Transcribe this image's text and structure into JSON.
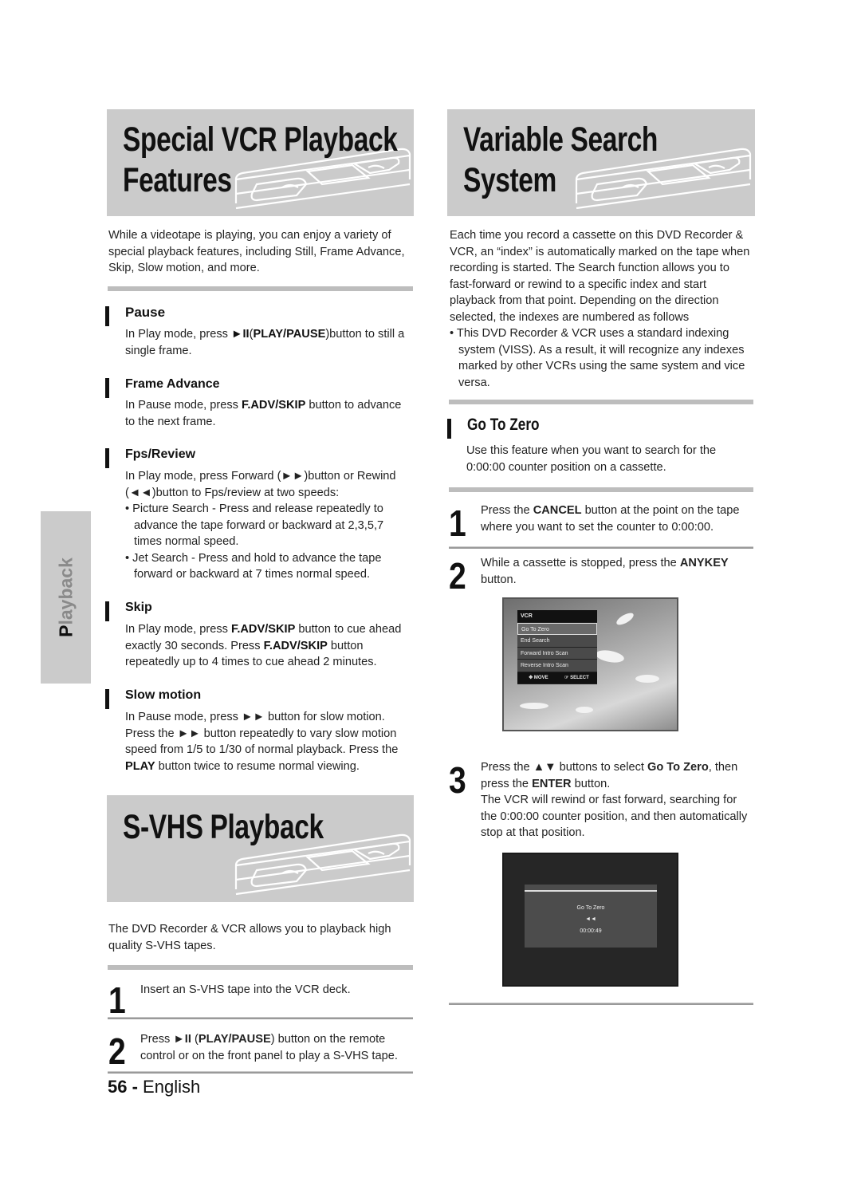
{
  "left_column": {
    "special_vcr": {
      "title_line1": "Special VCR Playback",
      "title_line2": "Features",
      "intro": "While a videotape is playing, you can enjoy a variety of special playback features, including Still, Frame Advance, Skip, Slow motion, and more.",
      "sections": [
        {
          "heading": "Pause",
          "text_parts": [
            "In Play mode, press ",
            "►II",
            "(",
            "PLAY/PAUSE",
            ")button to still a single frame."
          ]
        },
        {
          "heading": "Frame Advance",
          "text_parts": [
            "In Pause mode, press ",
            "F.ADV/SKIP",
            " button to advance to the next frame."
          ]
        },
        {
          "heading": "Fps/Review",
          "text": "In Play mode, press Forward (►►)button or Rewind (◄◄)button to Fps/review at two speeds:",
          "bullets": [
            "Picture Search - Press and release repeatedly to advance the tape forward or backward at 2,3,5,7 times normal speed.",
            "Jet Search - Press and hold to advance the tape forward or backward at 7 times normal speed."
          ]
        },
        {
          "heading": "Skip",
          "text_parts": [
            "In Play mode, press ",
            "F.ADV/SKIP",
            " button to cue ahead exactly 30 seconds. Press ",
            "F.ADV/SKIP",
            " button repeatedly up to 4 times to cue ahead 2 minutes."
          ]
        },
        {
          "heading": "Slow motion",
          "text_parts": [
            "In Pause mode, press ►► button for slow motion. Press the ►► button repeatedly to vary slow motion speed from 1/5 to 1/30 of normal playback. Press the ",
            "PLAY",
            " button twice to resume normal viewing."
          ]
        }
      ]
    },
    "svhs": {
      "title": "S-VHS Playback",
      "intro": "The DVD Recorder & VCR allows you to playback high quality S-VHS tapes.",
      "steps": [
        {
          "num": "1",
          "text": "Insert an S-VHS tape into the VCR deck."
        },
        {
          "num": "2",
          "text_parts": [
            "Press ",
            "►II",
            " (",
            "PLAY/PAUSE",
            ") button on the remote control or on the front panel to play a S-VHS tape."
          ]
        }
      ]
    }
  },
  "right_column": {
    "variable_search": {
      "title_line1": "Variable Search",
      "title_line2": "System",
      "intro": "Each time you record a cassette on this DVD Recorder & VCR, an “index” is automatically marked on the tape when recording is started. The Search function allows you to fast-forward or rewind to a specific index and start playback from that point. Depending on the direction selected, the indexes are numbered as follows",
      "bullet": "This DVD Recorder & VCR uses a standard indexing system (VISS). As a result, it will recognize any indexes marked by other VCRs using the same system and vice versa."
    },
    "go_to_zero": {
      "heading": "Go To Zero",
      "intro": "Use this feature when you want to search for the 0:00:00 counter position on a cassette.",
      "steps": [
        {
          "num": "1",
          "text_parts": [
            "Press the ",
            "CANCEL",
            " button at the point on the tape where you want to set the counter to 0:00:00."
          ]
        },
        {
          "num": "2",
          "text_parts": [
            "While a cassette is stopped, press the ",
            "ANYKEY",
            " button."
          ]
        },
        {
          "num": "3",
          "text_parts": [
            "Press the ▲▼ buttons to select ",
            "Go To Zero",
            ", then press the ",
            "ENTER",
            " button."
          ],
          "text2": "The VCR will rewind or fast forward, searching for the 0:00:00 counter position, and then automatically stop at that position."
        }
      ],
      "screen_menu": {
        "header": "VCR",
        "items": [
          "Go To Zero",
          "End Search",
          "Forward Intro Scan",
          "Reverse Intro Scan"
        ],
        "selected": "Go To Zero",
        "footer_move": "MOVE",
        "footer_select": "SELECT"
      },
      "screen_status": {
        "title": "Go To Zero",
        "icon": "◄◄",
        "counter": "00:00:49"
      }
    }
  },
  "side_tab": {
    "first_letter": "P",
    "rest": "layback"
  },
  "footer": {
    "page_number": "56",
    "separator": " - ",
    "language": "English"
  }
}
